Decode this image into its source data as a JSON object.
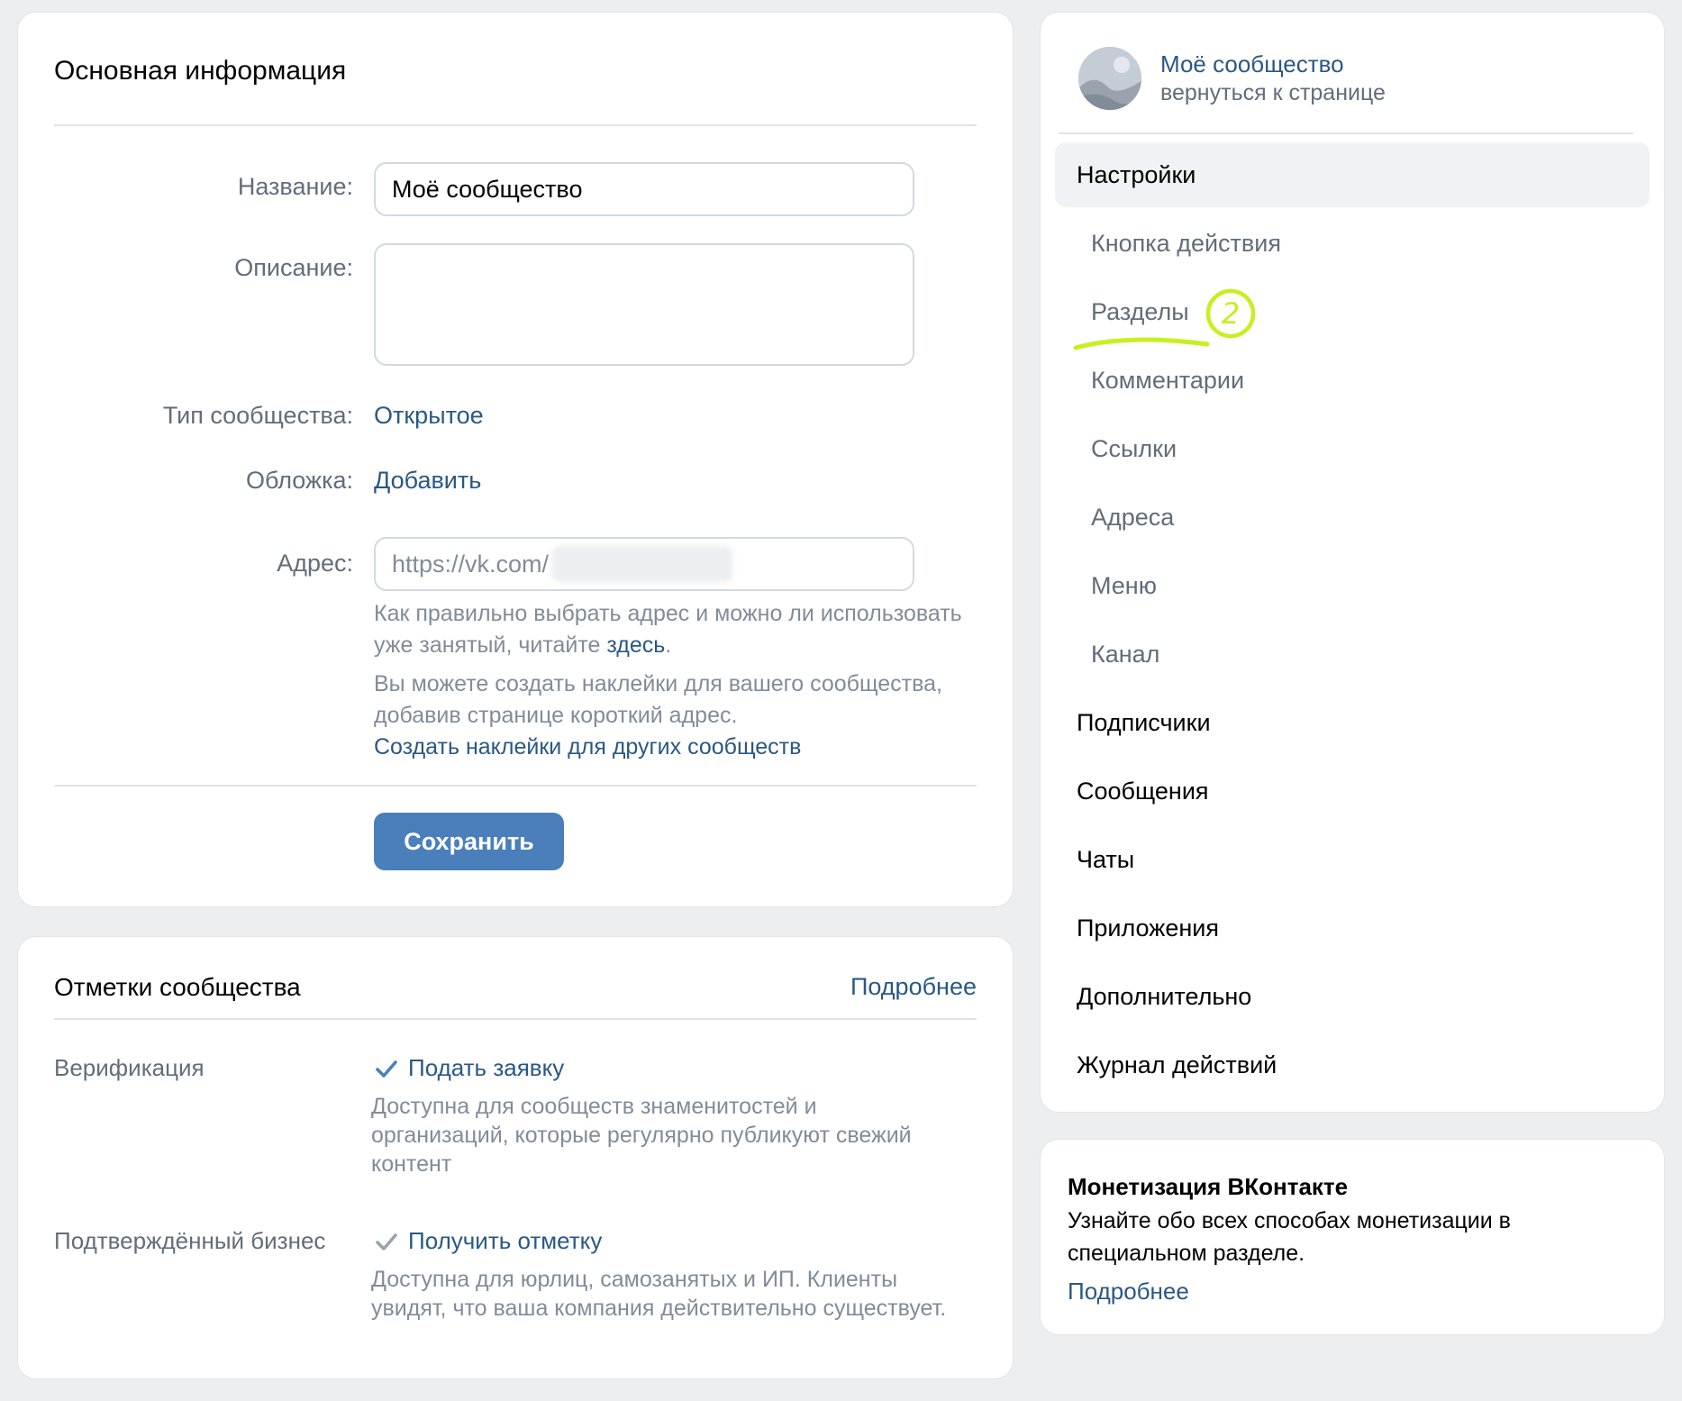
{
  "main": {
    "title": "Основная информация",
    "fields": {
      "name_label": "Название:",
      "name_value": "Моё сообщество",
      "description_label": "Описание:",
      "description_value": "",
      "type_label": "Тип сообщества:",
      "type_value": "Открытое",
      "cover_label": "Обложка:",
      "cover_value": "Добавить",
      "address_label": "Адрес:",
      "address_value": "https://vk.com/"
    },
    "hint1_text": "Как правильно выбрать адрес и можно ли использовать уже занятый, читайте ",
    "hint1_link": "здесь",
    "hint1_end": ".",
    "hint2_text": "Вы можете создать наклейки для вашего сообщества, добавив странице короткий адрес.",
    "hint2_link": "Создать наклейки для других сообществ",
    "save_button": "Сохранить"
  },
  "marks": {
    "title": "Отметки сообщества",
    "more_link": "Подробнее",
    "items": [
      {
        "label": "Верификация",
        "action": "Подать заявку",
        "description": "Доступна для сообществ знаменитостей и организаций, которые регулярно публикуют свежий контент"
      },
      {
        "label": "Подтверждённый бизнес",
        "action": "Получить отметку",
        "description": "Доступна для юрлиц, самозанятых и ИП. Клиенты увидят, что ваша компания действительно существует."
      }
    ]
  },
  "nav": {
    "community_name": "Моё сообщество",
    "community_back": "вернуться к странице",
    "items": [
      {
        "label": "Настройки",
        "active": true,
        "sub": false
      },
      {
        "label": "Кнопка действия",
        "sub": true
      },
      {
        "label": "Разделы",
        "sub": true
      },
      {
        "label": "Комментарии",
        "sub": true
      },
      {
        "label": "Ссылки",
        "sub": true
      },
      {
        "label": "Адреса",
        "sub": true
      },
      {
        "label": "Меню",
        "sub": true
      },
      {
        "label": "Канал",
        "sub": true
      },
      {
        "label": "Подписчики",
        "sub": false
      },
      {
        "label": "Сообщения",
        "sub": false
      },
      {
        "label": "Чаты",
        "sub": false
      },
      {
        "label": "Приложения",
        "sub": false
      },
      {
        "label": "Дополнительно",
        "sub": false
      },
      {
        "label": "Журнал действий",
        "sub": false
      }
    ],
    "annotation_number": "2",
    "annotation_color": "#c6f01f"
  },
  "monetization": {
    "title": "Монетизация ВКонтакте",
    "text": "Узнайте обо всех способах монетизации в специальном разделе.",
    "link": "Подробнее"
  },
  "colors": {
    "accent": "#2a5885",
    "button": "#4a7fbc",
    "page_bg": "#edeef0",
    "secondary_text": "#818c99"
  }
}
